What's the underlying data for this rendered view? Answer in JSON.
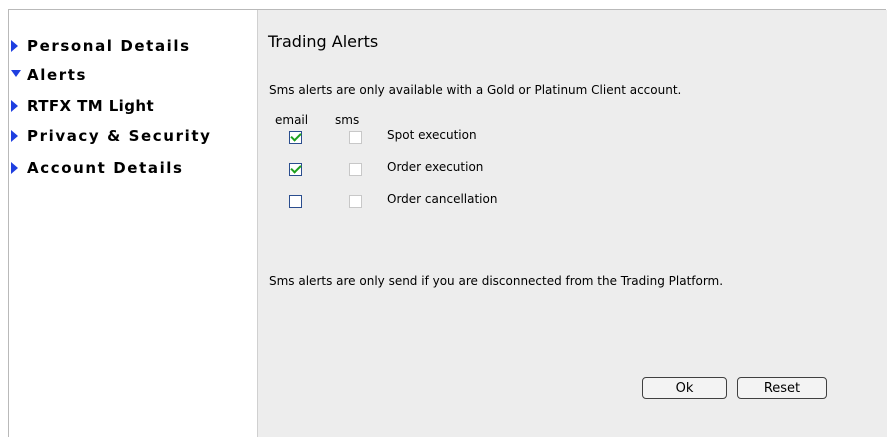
{
  "sidebar": {
    "items": [
      {
        "label": "Personal Details",
        "state": "collapsed",
        "icon": "arrow-right-icon"
      },
      {
        "label": "Alerts",
        "state": "expanded",
        "icon": "arrow-down-icon"
      },
      {
        "label": "RTFX TM  Light",
        "state": "collapsed",
        "icon": "arrow-right-icon"
      },
      {
        "label": "Privacy & Security",
        "state": "collapsed",
        "icon": "arrow-right-icon"
      },
      {
        "label": "Account Details",
        "state": "collapsed",
        "icon": "arrow-right-icon"
      }
    ]
  },
  "main": {
    "title": "Trading Alerts",
    "info_top": "Sms alerts are only available with a Gold or Platinum Client account.",
    "col_email": "email",
    "col_sms": "sms",
    "alerts": [
      {
        "label": "Spot execution",
        "email": true,
        "sms": false
      },
      {
        "label": "Order execution",
        "email": true,
        "sms": false
      },
      {
        "label": "Order cancellation",
        "email": false,
        "sms": false
      }
    ],
    "info_bottom": "Sms alerts are only send if you are disconnected from the Trading Platform.",
    "ok_label": "Ok",
    "reset_label": "Reset"
  },
  "colors": {
    "arrow": "#1f3fe0",
    "panel_bg": "#ededed",
    "check": "#1ea01e"
  }
}
